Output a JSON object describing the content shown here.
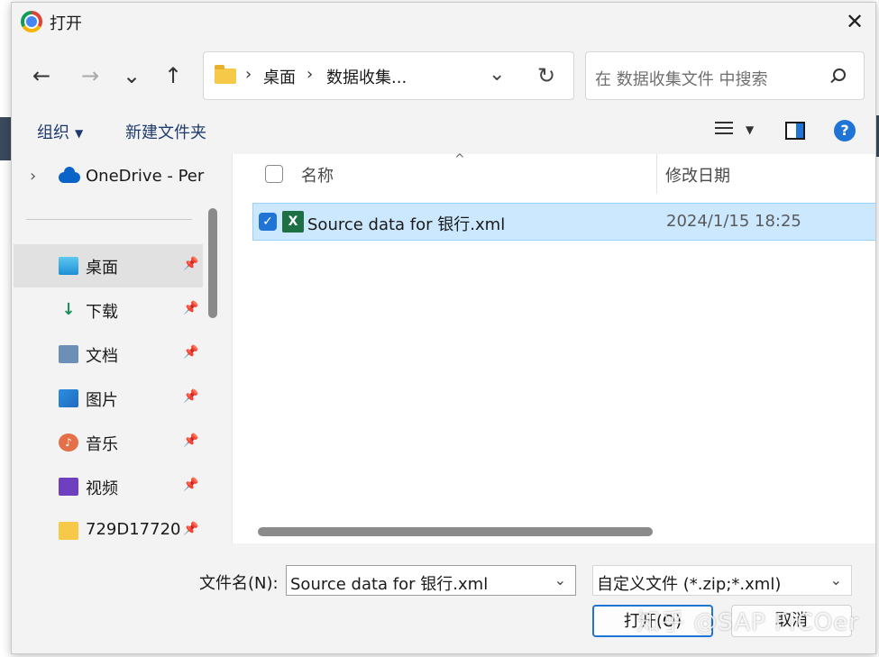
{
  "window": {
    "title": "打开"
  },
  "nav": {
    "back": "←",
    "forward": "→",
    "recent": "⌄",
    "up": "↑",
    "breadcrumb": [
      "桌面",
      "数据收集..."
    ],
    "refresh": "↻",
    "dropdown": "⌄",
    "search_placeholder": "在 数据收集文件 中搜索"
  },
  "toolbar": {
    "organize": "组织",
    "new_folder": "新建文件夹",
    "help": "?"
  },
  "sidebar": {
    "onedrive": "OneDrive - Per",
    "items": [
      {
        "label": "桌面",
        "icon": "desktop-icon",
        "active": true
      },
      {
        "label": "下载",
        "icon": "download-icon",
        "glyph": "↓"
      },
      {
        "label": "文档",
        "icon": "document-icon"
      },
      {
        "label": "图片",
        "icon": "pictures-icon"
      },
      {
        "label": "音乐",
        "icon": "music-icon",
        "glyph": "♪"
      },
      {
        "label": "视频",
        "icon": "video-icon"
      },
      {
        "label": "729D17720",
        "icon": "folder-icon"
      }
    ]
  },
  "list": {
    "columns": {
      "name": "名称",
      "modified": "修改日期"
    },
    "files": [
      {
        "name": "Source data for 银行.xml",
        "modified": "2024/1/15 18:25",
        "selected": true,
        "icon": "excel-icon"
      }
    ]
  },
  "footer": {
    "filename_label": "文件名(N):",
    "filename_value": "Source data for 银行.xml",
    "filetype_value": "自定义文件 (*.zip;*.xml)",
    "open_button": "打开(O)",
    "cancel_button": "取消"
  },
  "watermark": "知乎 @SAP FICOer",
  "colors": {
    "accent": "#1f74d6",
    "selection": "#cce8ff",
    "excel": "#1d7044"
  }
}
